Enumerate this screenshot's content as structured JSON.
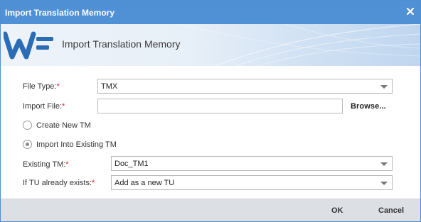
{
  "window": {
    "title": "Import Translation Memory",
    "close_icon": "close-icon"
  },
  "banner": {
    "title": "Import Translation Memory",
    "logo_text": "WF",
    "logo_color": "#2a6db5"
  },
  "form": {
    "file_type": {
      "label": "File Type:",
      "required_mark": "*",
      "value": "TMX"
    },
    "import_file": {
      "label": "Import File:",
      "required_mark": "*",
      "value": "",
      "browse_label": "Browse..."
    },
    "create_new_tm": {
      "label": "Create New TM",
      "checked": false
    },
    "import_existing": {
      "label": "Import Into Existing TM",
      "checked": true
    },
    "existing_tm": {
      "label": "Existing TM:",
      "required_mark": "*",
      "value": "Doc_TM1"
    },
    "tu_exists": {
      "label": "If TU already exists:",
      "required_mark": "*",
      "value": "Add as a new TU"
    }
  },
  "footer": {
    "ok_label": "OK",
    "cancel_label": "Cancel"
  },
  "colors": {
    "titlebar": "#4f91d4",
    "required": "#e02020",
    "footer": "#dcdfe4"
  }
}
